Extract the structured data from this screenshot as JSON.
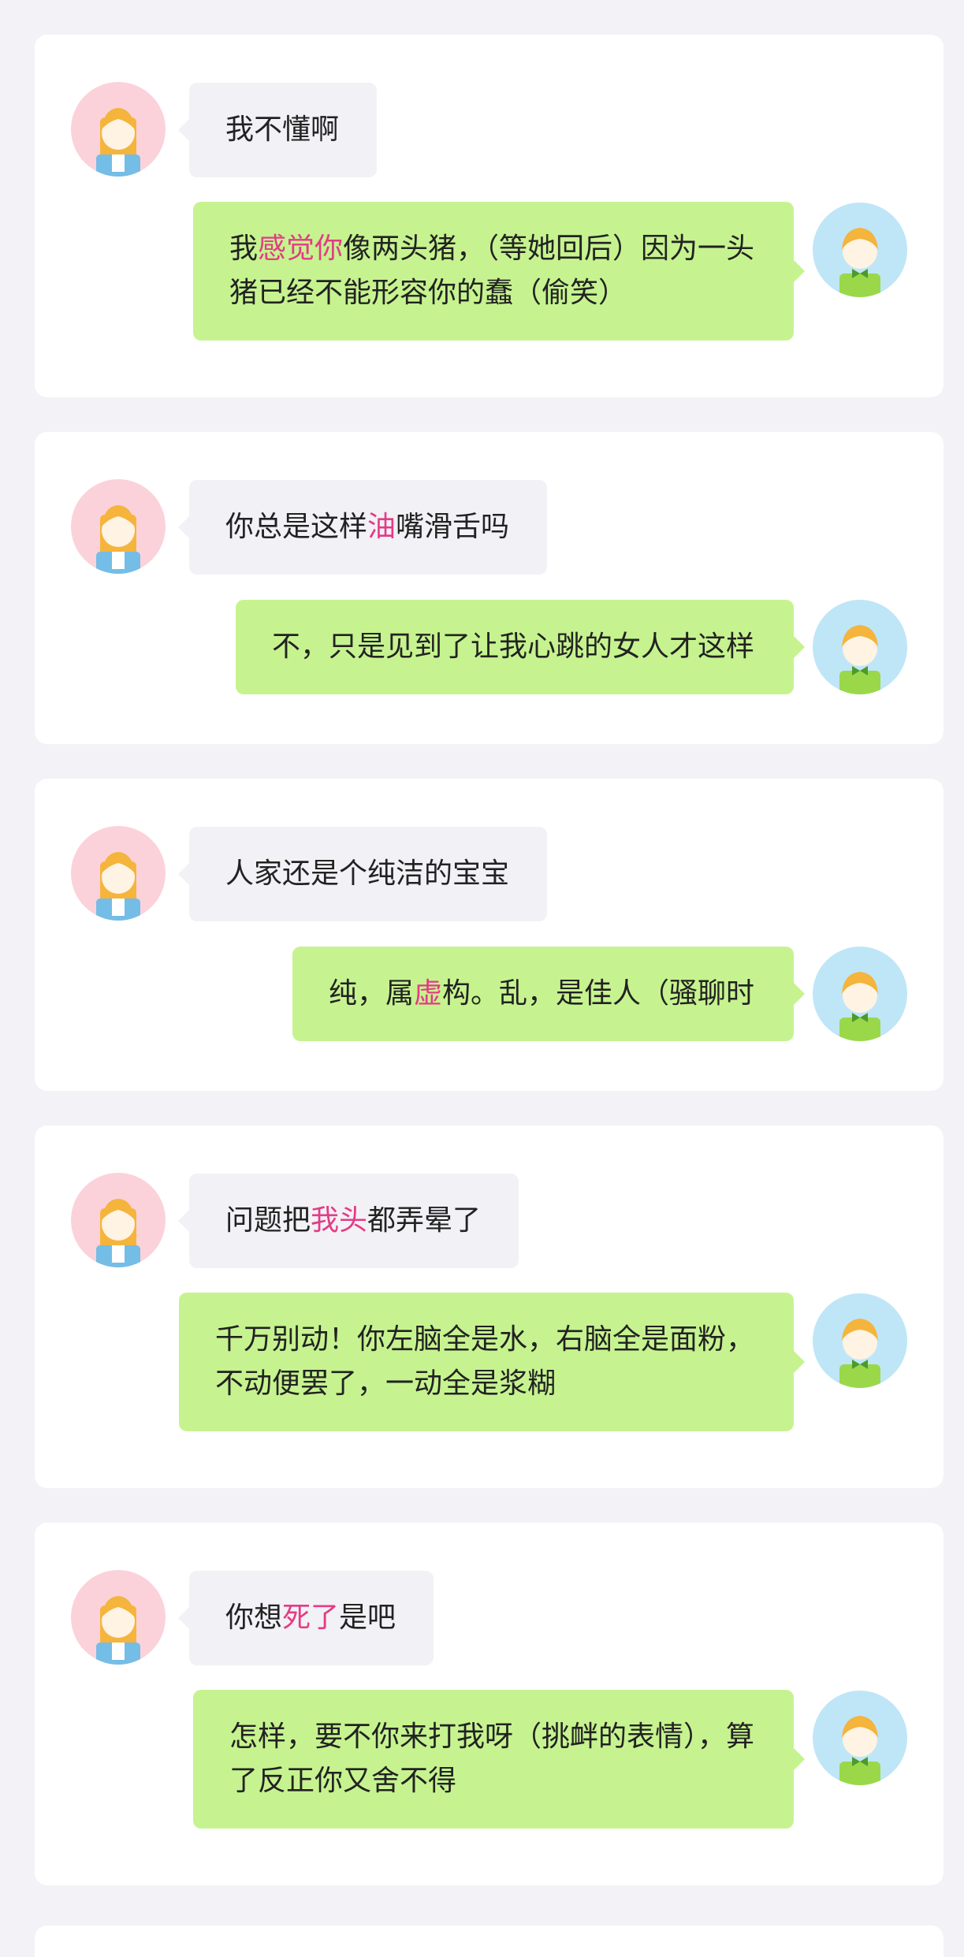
{
  "conversations": [
    {
      "her": [
        [
          {
            "t": "我不懂啊",
            "h": false
          }
        ]
      ],
      "him": [
        [
          {
            "t": "我",
            "h": false
          },
          {
            "t": "感觉你",
            "h": true
          },
          {
            "t": "像两头猪，（等她回后）因为一头",
            "h": false
          }
        ],
        [
          {
            "t": "猪已经不能形容你的蠢（偷笑）",
            "h": false
          }
        ]
      ]
    },
    {
      "her": [
        [
          {
            "t": "你总是这样",
            "h": false
          },
          {
            "t": "油",
            "h": true
          },
          {
            "t": "嘴滑舌吗",
            "h": false
          }
        ]
      ],
      "him": [
        [
          {
            "t": "不，只是见到了让我心跳的女人才这样",
            "h": false
          }
        ]
      ]
    },
    {
      "her": [
        [
          {
            "t": "人家还是个纯洁的宝宝",
            "h": false
          }
        ]
      ],
      "him": [
        [
          {
            "t": "纯，属",
            "h": false
          },
          {
            "t": "虚",
            "h": true
          },
          {
            "t": "构。乱，是佳人（骚聊时",
            "h": false
          }
        ]
      ]
    },
    {
      "her": [
        [
          {
            "t": "问题把",
            "h": false
          },
          {
            "t": "我头",
            "h": true
          },
          {
            "t": "都弄晕了",
            "h": false
          }
        ]
      ],
      "him": [
        [
          {
            "t": "千万别动！你左脑全是水，右脑全是面粉，",
            "h": false
          }
        ],
        [
          {
            "t": "不动便罢了，一动全是浆糊",
            "h": false
          }
        ]
      ]
    },
    {
      "her": [
        [
          {
            "t": "你想",
            "h": false
          },
          {
            "t": "死了",
            "h": true
          },
          {
            "t": "是吧",
            "h": false
          }
        ]
      ],
      "him": [
        [
          {
            "t": "怎样，要不你来打我呀（挑衅的表情），算",
            "h": false
          }
        ],
        [
          {
            "t": "了反正你又舍不得",
            "h": false
          }
        ]
      ]
    }
  ],
  "colors": {
    "background": "#f3f2f7",
    "card": "#ffffff",
    "her_bubble": "#f2f1f5",
    "his_bubble": "#c6f38f",
    "highlight_text": "#e43b86",
    "her_avatar_bg": "#fcd2da",
    "his_avatar_bg": "#bfe6f7"
  },
  "icons": {
    "her_avatar": "girl-avatar-icon",
    "his_avatar": "boy-avatar-icon"
  }
}
